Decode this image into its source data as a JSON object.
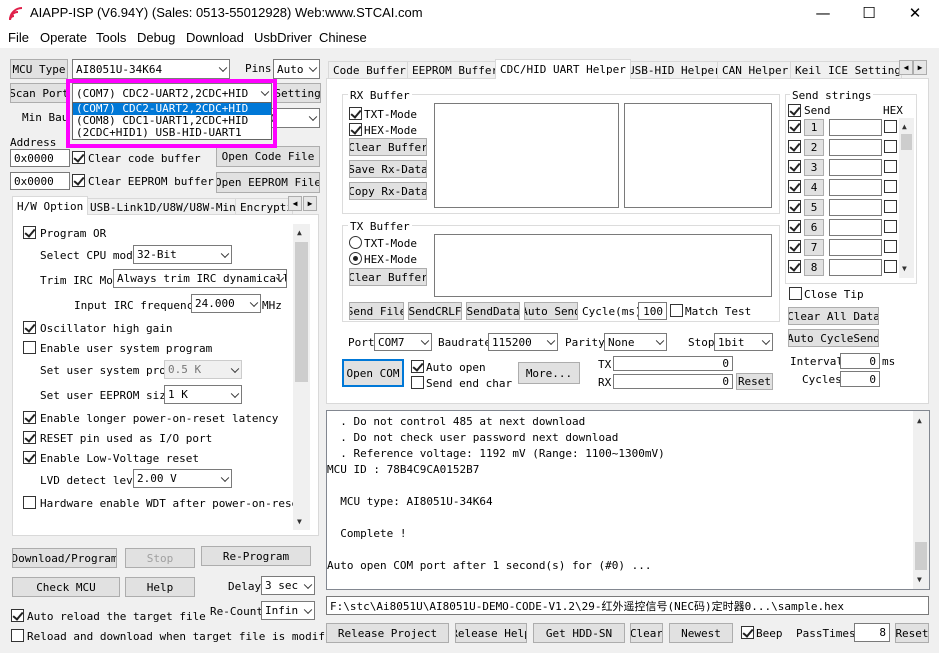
{
  "window": {
    "title": "AIAPP-ISP (V6.94Y) (Sales: 0513-55012928) Web:www.STCAI.com",
    "minimize": "—",
    "maximize": "☐",
    "close": "✕",
    "icon": "wifi-icon"
  },
  "menu": [
    "File",
    "Operate",
    "Tools",
    "Debug",
    "Download",
    "UsbDriver",
    "Chinese"
  ],
  "left": {
    "mcu_type_btn": "MCU Type",
    "mcu_type_value": "AI8051U-34K64",
    "pins_label": "Pins",
    "pins_value": "Auto",
    "scan_port_btn": "Scan Port",
    "port_value": "(COM7) CDC2-UART2,2CDC+HID",
    "port_options": [
      "(COM7) CDC2-UART2,2CDC+HID",
      "(COM8) CDC1-UART1,2CDC+HID",
      "(2CDC+HID1) USB-HID-UART1"
    ],
    "setting_btn": "Setting",
    "min_baud_label": "Min Bau",
    "min_baud_value": "0",
    "address_label": "Address",
    "addr1": "0x0000",
    "addr2": "0x0000",
    "clear_code": "Clear code buffer",
    "clear_eeprom": "Clear EEPROM buffer",
    "open_code": "Open Code File",
    "open_eeprom": "Open EEPROM File",
    "tabs": [
      "H/W Option",
      "USB-Link1D/U8W/U8W-Mini",
      "Encrypti"
    ],
    "opts": {
      "program_or": "Program OR",
      "cpu_mode_label": "Select CPU mode",
      "cpu_mode_value": "32-Bit",
      "trim_label": "Trim IRC Mo",
      "trim_value": "Always trim IRC dynamicall",
      "irc_label": "Input IRC frequency",
      "irc_value": "24.000",
      "irc_unit": "MHz",
      "osc_gain": "Oscillator high gain",
      "user_prog": "Enable user system program",
      "user_prog_label": "Set user system prog",
      "user_prog_value": "0.5 K",
      "user_eeprom_label": "Set user EEPROM size",
      "user_eeprom_value": "1  K",
      "longer_reset": "Enable longer power-on-reset latency",
      "reset_io": "RESET pin used as I/O port",
      "low_volt": "Enable Low-Voltage reset",
      "lvd_label": "LVD detect leve",
      "lvd_value": "2.00 V",
      "hw_wdt": "Hardware enable WDT after power-on-reset"
    },
    "download_btn": "Download/Program",
    "stop_btn": "Stop",
    "reprogram_btn": "Re-Program",
    "check_mcu_btn": "Check MCU",
    "help_btn": "Help",
    "delay_label": "Delay",
    "delay_value": "3 sec",
    "auto_reload": "Auto reload the target file",
    "recount_label": "Re-Count",
    "recount_value": "Infin",
    "reload_download": "Reload and download when target file is modified"
  },
  "right": {
    "tabs": [
      "Code Buffer",
      "EEPROM Buffer",
      "CDC/HID UART Helper",
      "USB-HID Helper",
      "CAN Helper",
      "Keil ICE Settings"
    ],
    "rx_buffer": "RX Buffer",
    "txt_mode": "TXT-Mode",
    "hex_mode": "HEX-Mode",
    "clear_buffer": "Clear Buffer",
    "save_rx": "Save Rx-Data",
    "copy_rx": "Copy Rx-Data",
    "tx_buffer": "TX Buffer",
    "send_file": "Send File",
    "send_crlf": "SendCRLF",
    "send_data": "SendData",
    "auto_send": "Auto Send",
    "cycle_label": "Cycle(ms)",
    "cycle_value": "100",
    "match_test": "Match Test",
    "send_strings": "Send strings",
    "send_col": "Send",
    "hex_col": "HEX",
    "send_rows": [
      "1",
      "2",
      "3",
      "4",
      "5",
      "6",
      "7",
      "8"
    ],
    "close_tip": "Close Tip",
    "clear_all": "Clear All Data",
    "auto_cycle": "Auto CycleSend",
    "interval_label": "Interval",
    "interval_value": "0",
    "interval_unit": "ms",
    "cycles_label": "Cycles",
    "cycles_value": "0",
    "port_label": "Port",
    "port_value": "COM7",
    "baud_label": "Baudrate",
    "baud_value": "115200",
    "parity_label": "Parity",
    "parity_value": "None",
    "stop_label": "Stop",
    "stop_value": "1bit",
    "open_com": "Open COM",
    "auto_open": "Auto open",
    "send_end": "Send end char",
    "more": "More...",
    "tx_label": "TX",
    "rx_label": "RX",
    "tx_value": "0",
    "rx_value": "0",
    "reset_btn": "Reset"
  },
  "log": [
    "  . Do not control 485 at next download",
    "  . Do not check user password next download",
    "  . Reference voltage: 1192 mV (Range: 1100~1300mV)",
    "MCU ID : 78B4C9CA0152B7",
    "",
    "  MCU type: AI8051U-34K64",
    "",
    "  Complete !",
    "",
    "Auto open COM port after 1 second(s) for (#0) ..."
  ],
  "path": "F:\\stc\\Ai8051U\\AI8051U-DEMO-CODE-V1.2\\29-红外遥控信号(NEC码)定时器0...\\sample.hex",
  "bottom": {
    "release_project": "Release Project",
    "release_help": "Release Help",
    "get_hdd": "Get HDD-SN",
    "clear": "Clear",
    "newest": "Newest",
    "beep": "Beep",
    "pass_label": "PassTimes",
    "pass_value": "8",
    "reset": "Reset"
  },
  "colors": {
    "highlight": "#ff00ff",
    "selection": "#0078d7"
  }
}
